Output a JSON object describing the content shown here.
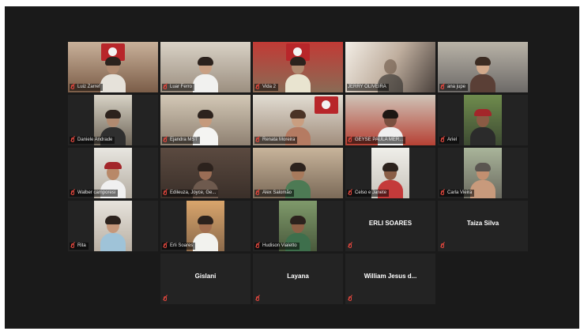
{
  "meeting": {
    "participants": [
      {
        "name": "Luiz Zarref",
        "type": "video",
        "flag": true
      },
      {
        "name": "Luar Ferro",
        "type": "video"
      },
      {
        "name": "Vida 2",
        "type": "video",
        "flag": true
      },
      {
        "name": "JERRY OLIVEIRA",
        "type": "video",
        "active_speaker": true
      },
      {
        "name": "ana jupe",
        "type": "video"
      },
      {
        "name": "Daniele Andrade",
        "type": "video"
      },
      {
        "name": "Ejandra MST",
        "type": "video"
      },
      {
        "name": "Renata Moreira",
        "type": "video",
        "flag": true
      },
      {
        "name": "GEYSE PAULA MER...",
        "type": "video"
      },
      {
        "name": "Ariel",
        "type": "video"
      },
      {
        "name": "Walber camporesi",
        "type": "video"
      },
      {
        "name": "Edileuza, Joyce, Ge...",
        "type": "video"
      },
      {
        "name": "Alex Salomão",
        "type": "video"
      },
      {
        "name": "Celso e Janete",
        "type": "video"
      },
      {
        "name": "Carla Vieira",
        "type": "video"
      },
      {
        "name": "Rita",
        "type": "video"
      },
      {
        "name": "Erli Soares",
        "type": "video"
      },
      {
        "name": "Hudison Vialetto",
        "type": "video"
      },
      {
        "name": "ERLI SOARES",
        "type": "name_only"
      },
      {
        "name": "Taiza Silva",
        "type": "name_only"
      },
      {
        "name": "Gislani",
        "type": "name_only"
      },
      {
        "name": "Layana",
        "type": "name_only"
      },
      {
        "name": "William Jesus d...",
        "type": "name_only"
      }
    ]
  },
  "colors": {
    "meeting_background": "#1a1a1a",
    "tile_background": "#232323",
    "muted_icon": "#e0463d",
    "active_speaker_border": "#c9d36a"
  },
  "icons": {
    "muted": "microphone-muted-icon"
  }
}
